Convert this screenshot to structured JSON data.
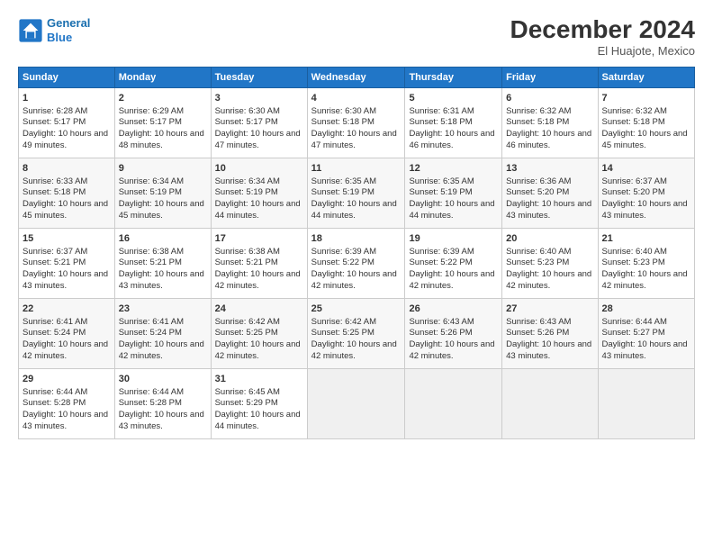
{
  "header": {
    "logo_line1": "General",
    "logo_line2": "Blue",
    "month": "December 2024",
    "location": "El Huajote, Mexico"
  },
  "days_of_week": [
    "Sunday",
    "Monday",
    "Tuesday",
    "Wednesday",
    "Thursday",
    "Friday",
    "Saturday"
  ],
  "weeks": [
    [
      {
        "day": "1",
        "sunrise": "Sunrise: 6:28 AM",
        "sunset": "Sunset: 5:17 PM",
        "daylight": "Daylight: 10 hours and 49 minutes."
      },
      {
        "day": "2",
        "sunrise": "Sunrise: 6:29 AM",
        "sunset": "Sunset: 5:17 PM",
        "daylight": "Daylight: 10 hours and 48 minutes."
      },
      {
        "day": "3",
        "sunrise": "Sunrise: 6:30 AM",
        "sunset": "Sunset: 5:17 PM",
        "daylight": "Daylight: 10 hours and 47 minutes."
      },
      {
        "day": "4",
        "sunrise": "Sunrise: 6:30 AM",
        "sunset": "Sunset: 5:18 PM",
        "daylight": "Daylight: 10 hours and 47 minutes."
      },
      {
        "day": "5",
        "sunrise": "Sunrise: 6:31 AM",
        "sunset": "Sunset: 5:18 PM",
        "daylight": "Daylight: 10 hours and 46 minutes."
      },
      {
        "day": "6",
        "sunrise": "Sunrise: 6:32 AM",
        "sunset": "Sunset: 5:18 PM",
        "daylight": "Daylight: 10 hours and 46 minutes."
      },
      {
        "day": "7",
        "sunrise": "Sunrise: 6:32 AM",
        "sunset": "Sunset: 5:18 PM",
        "daylight": "Daylight: 10 hours and 45 minutes."
      }
    ],
    [
      {
        "day": "8",
        "sunrise": "Sunrise: 6:33 AM",
        "sunset": "Sunset: 5:18 PM",
        "daylight": "Daylight: 10 hours and 45 minutes."
      },
      {
        "day": "9",
        "sunrise": "Sunrise: 6:34 AM",
        "sunset": "Sunset: 5:19 PM",
        "daylight": "Daylight: 10 hours and 45 minutes."
      },
      {
        "day": "10",
        "sunrise": "Sunrise: 6:34 AM",
        "sunset": "Sunset: 5:19 PM",
        "daylight": "Daylight: 10 hours and 44 minutes."
      },
      {
        "day": "11",
        "sunrise": "Sunrise: 6:35 AM",
        "sunset": "Sunset: 5:19 PM",
        "daylight": "Daylight: 10 hours and 44 minutes."
      },
      {
        "day": "12",
        "sunrise": "Sunrise: 6:35 AM",
        "sunset": "Sunset: 5:19 PM",
        "daylight": "Daylight: 10 hours and 44 minutes."
      },
      {
        "day": "13",
        "sunrise": "Sunrise: 6:36 AM",
        "sunset": "Sunset: 5:20 PM",
        "daylight": "Daylight: 10 hours and 43 minutes."
      },
      {
        "day": "14",
        "sunrise": "Sunrise: 6:37 AM",
        "sunset": "Sunset: 5:20 PM",
        "daylight": "Daylight: 10 hours and 43 minutes."
      }
    ],
    [
      {
        "day": "15",
        "sunrise": "Sunrise: 6:37 AM",
        "sunset": "Sunset: 5:21 PM",
        "daylight": "Daylight: 10 hours and 43 minutes."
      },
      {
        "day": "16",
        "sunrise": "Sunrise: 6:38 AM",
        "sunset": "Sunset: 5:21 PM",
        "daylight": "Daylight: 10 hours and 43 minutes."
      },
      {
        "day": "17",
        "sunrise": "Sunrise: 6:38 AM",
        "sunset": "Sunset: 5:21 PM",
        "daylight": "Daylight: 10 hours and 42 minutes."
      },
      {
        "day": "18",
        "sunrise": "Sunrise: 6:39 AM",
        "sunset": "Sunset: 5:22 PM",
        "daylight": "Daylight: 10 hours and 42 minutes."
      },
      {
        "day": "19",
        "sunrise": "Sunrise: 6:39 AM",
        "sunset": "Sunset: 5:22 PM",
        "daylight": "Daylight: 10 hours and 42 minutes."
      },
      {
        "day": "20",
        "sunrise": "Sunrise: 6:40 AM",
        "sunset": "Sunset: 5:23 PM",
        "daylight": "Daylight: 10 hours and 42 minutes."
      },
      {
        "day": "21",
        "sunrise": "Sunrise: 6:40 AM",
        "sunset": "Sunset: 5:23 PM",
        "daylight": "Daylight: 10 hours and 42 minutes."
      }
    ],
    [
      {
        "day": "22",
        "sunrise": "Sunrise: 6:41 AM",
        "sunset": "Sunset: 5:24 PM",
        "daylight": "Daylight: 10 hours and 42 minutes."
      },
      {
        "day": "23",
        "sunrise": "Sunrise: 6:41 AM",
        "sunset": "Sunset: 5:24 PM",
        "daylight": "Daylight: 10 hours and 42 minutes."
      },
      {
        "day": "24",
        "sunrise": "Sunrise: 6:42 AM",
        "sunset": "Sunset: 5:25 PM",
        "daylight": "Daylight: 10 hours and 42 minutes."
      },
      {
        "day": "25",
        "sunrise": "Sunrise: 6:42 AM",
        "sunset": "Sunset: 5:25 PM",
        "daylight": "Daylight: 10 hours and 42 minutes."
      },
      {
        "day": "26",
        "sunrise": "Sunrise: 6:43 AM",
        "sunset": "Sunset: 5:26 PM",
        "daylight": "Daylight: 10 hours and 42 minutes."
      },
      {
        "day": "27",
        "sunrise": "Sunrise: 6:43 AM",
        "sunset": "Sunset: 5:26 PM",
        "daylight": "Daylight: 10 hours and 43 minutes."
      },
      {
        "day": "28",
        "sunrise": "Sunrise: 6:44 AM",
        "sunset": "Sunset: 5:27 PM",
        "daylight": "Daylight: 10 hours and 43 minutes."
      }
    ],
    [
      {
        "day": "29",
        "sunrise": "Sunrise: 6:44 AM",
        "sunset": "Sunset: 5:28 PM",
        "daylight": "Daylight: 10 hours and 43 minutes."
      },
      {
        "day": "30",
        "sunrise": "Sunrise: 6:44 AM",
        "sunset": "Sunset: 5:28 PM",
        "daylight": "Daylight: 10 hours and 43 minutes."
      },
      {
        "day": "31",
        "sunrise": "Sunrise: 6:45 AM",
        "sunset": "Sunset: 5:29 PM",
        "daylight": "Daylight: 10 hours and 44 minutes."
      },
      null,
      null,
      null,
      null
    ]
  ]
}
